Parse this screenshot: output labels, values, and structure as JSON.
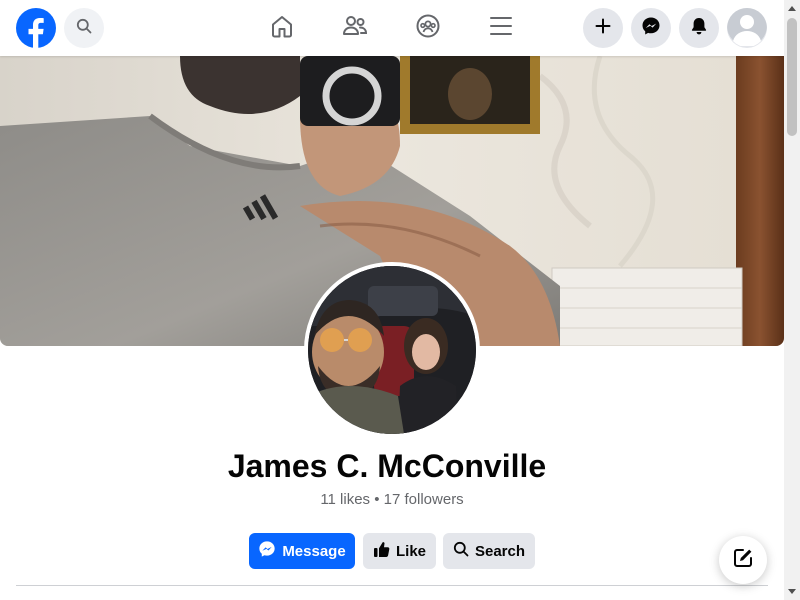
{
  "nav": {
    "logo_icon": "facebook-logo-icon",
    "search_icon": "search-icon",
    "tabs": [
      {
        "name": "home",
        "icon": "home-icon"
      },
      {
        "name": "friends",
        "icon": "friends-icon"
      },
      {
        "name": "groups",
        "icon": "groups-icon"
      },
      {
        "name": "menu",
        "icon": "menu-icon"
      }
    ],
    "right_buttons": [
      {
        "name": "create",
        "icon": "plus-icon"
      },
      {
        "name": "messenger",
        "icon": "messenger-icon"
      },
      {
        "name": "notifications",
        "icon": "bell-icon"
      },
      {
        "name": "account",
        "icon": "avatar-icon"
      }
    ]
  },
  "profile": {
    "name": "James C. McConville",
    "stats": "11 likes • 17 followers"
  },
  "actions": {
    "message_label": "Message",
    "like_label": "Like",
    "search_label": "Search"
  },
  "colors": {
    "brand_blue": "#0866ff",
    "button_gray": "#e4e6eb",
    "text_primary": "#050505",
    "text_secondary": "#65676b"
  }
}
